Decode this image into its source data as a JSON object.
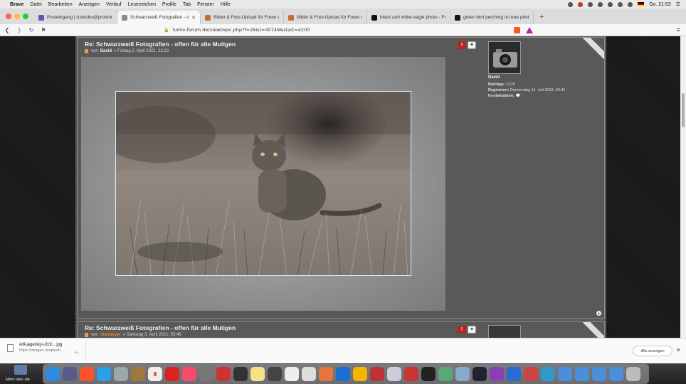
{
  "menubar": {
    "app": "Brave",
    "items": [
      "Datei",
      "Bearbeiten",
      "Anzeigen",
      "Verlauf",
      "Lesezeichen",
      "Profile",
      "Tab",
      "Fenster",
      "Hilfe"
    ],
    "clock": "Do. 21:53"
  },
  "tabs": [
    {
      "label": "Posteingang | d.lender@protonmail",
      "color": "#6b4fbb",
      "active": false
    },
    {
      "label": "Schwarzweiß Fotografien - offen",
      "color": "#8a8a8a",
      "active": true
    },
    {
      "label": "Bilder & Foto-Upload für Foren und",
      "color": "#c96b2c",
      "active": false
    },
    {
      "label": "Bilder & Foto-Upload für Foren und",
      "color": "#c96b2c",
      "active": false
    },
    {
      "label": "black and white eagle photo - Free",
      "color": "#111111",
      "active": false
    },
    {
      "label": "green bird perching on tree photo",
      "color": "#111111",
      "active": false
    }
  ],
  "address": {
    "url": "lumix-forum.de/viewtopic.php?f=26&t=40749&start=4200"
  },
  "posts": [
    {
      "title": "Re: Schwarzweiß Fotografien - offen für alle Mutigen",
      "by": "von",
      "author": "David",
      "date": "» Freitag 2. April 2021, 23:13"
    },
    {
      "title": "Re: Schwarzweiß Fotografien - offen für alle Mutigen",
      "by": "von",
      "author": "oberbeyer",
      "date": "» Samstag 3. April 2021, 05:46"
    }
  ],
  "profile": {
    "name": "David",
    "posts_label": "Beiträge:",
    "posts_value": "1276",
    "registered_label": "Registriert:",
    "registered_value": "Donnerstag 11. Juli 2019, 09:41",
    "contact_label": "Kontaktdaten:"
  },
  "actions": {
    "report": "!",
    "quote": "❝"
  },
  "download": {
    "filename": "will-jagelsky-uf19....jpg",
    "source": "https://images.unsplash...",
    "show_all": "Alle anzeigen"
  },
  "desktop": {
    "label": "Mehr über die"
  },
  "colors": {
    "accent_orange": "#e98a2b",
    "report_red": "#b52525",
    "forum_bg": "#5a5a5a"
  }
}
